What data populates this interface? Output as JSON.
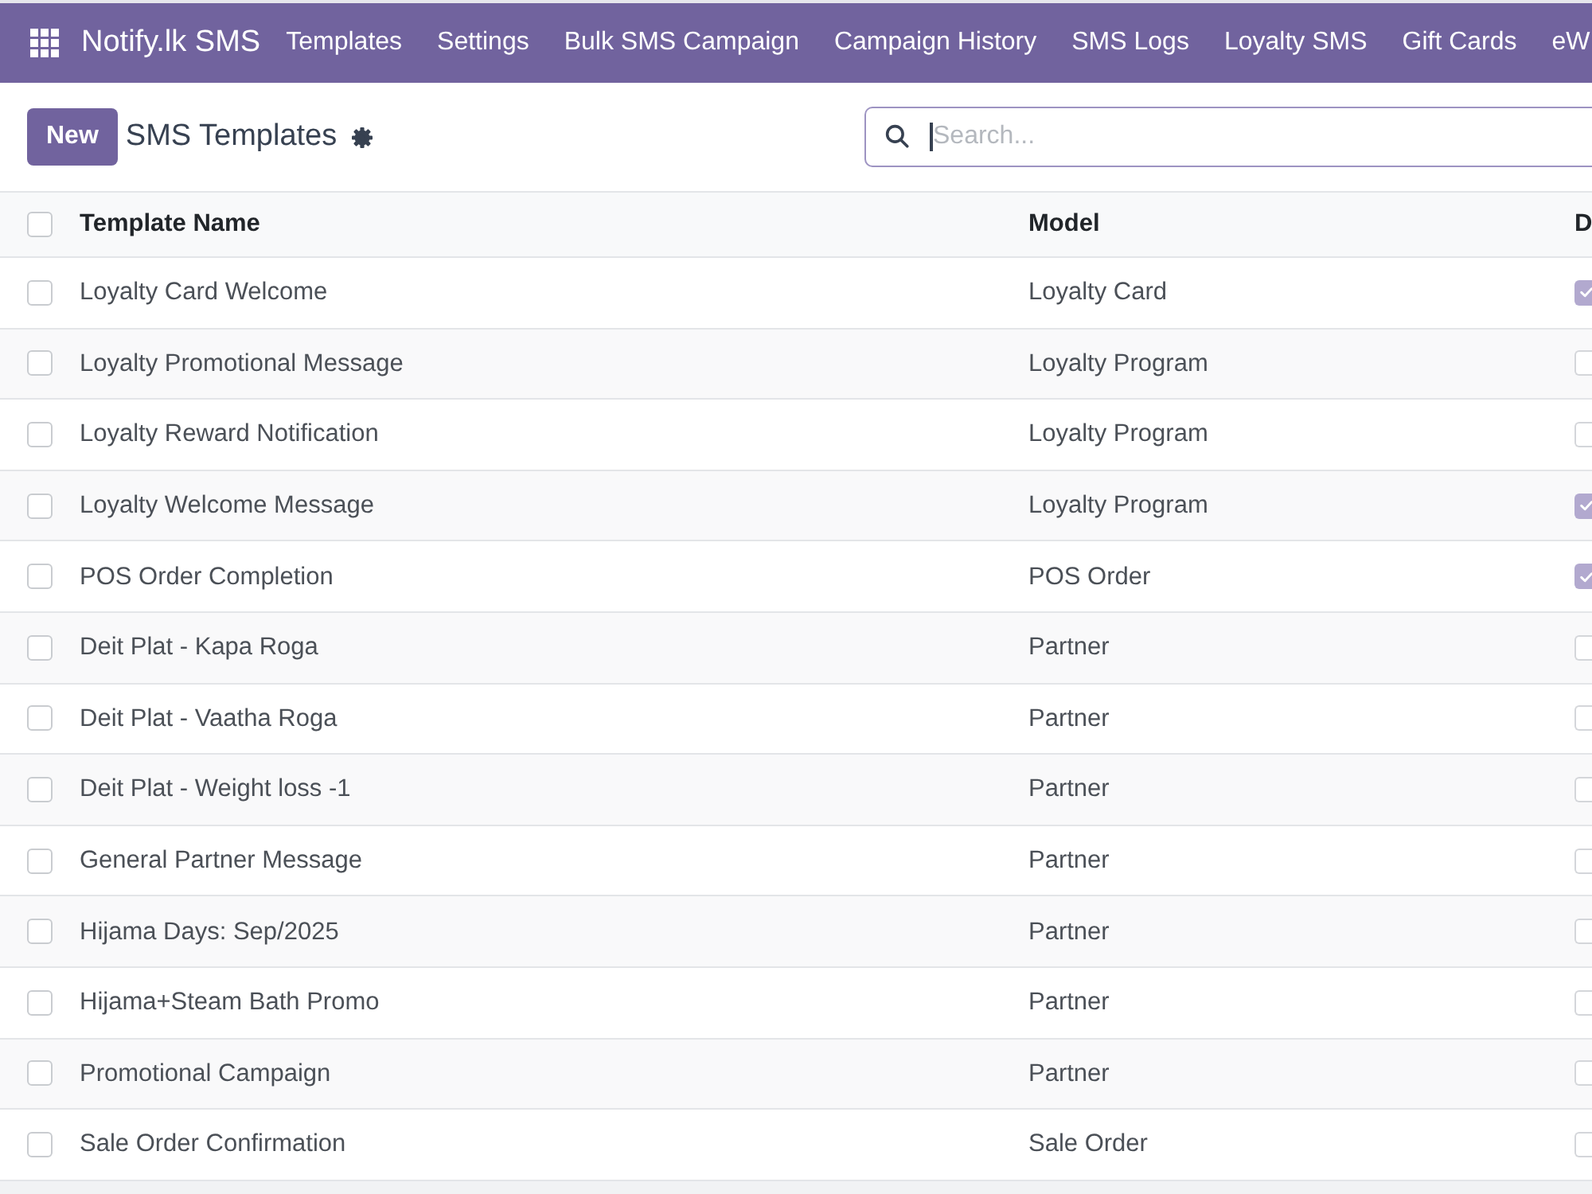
{
  "navbar": {
    "brand": "Notify.lk SMS",
    "menu": [
      "Templates",
      "Settings",
      "Bulk SMS Campaign",
      "Campaign History",
      "SMS Logs",
      "Loyalty SMS",
      "Gift Cards",
      "eW"
    ]
  },
  "control_panel": {
    "new_button": "New",
    "title": "SMS Templates",
    "search": {
      "placeholder": "Search..."
    }
  },
  "table": {
    "select_all": {
      "checked": false
    },
    "columns": [
      "Template Name",
      "Model",
      "D"
    ],
    "rows": [
      {
        "selected": false,
        "name": "Loyalty Card Welcome",
        "model": "Loyalty Card",
        "column_3_checked": true
      },
      {
        "selected": false,
        "name": "Loyalty Promotional Message",
        "model": "Loyalty Program",
        "column_3_checked": false
      },
      {
        "selected": false,
        "name": "Loyalty Reward Notification",
        "model": "Loyalty Program",
        "column_3_checked": false
      },
      {
        "selected": false,
        "name": "Loyalty Welcome Message",
        "model": "Loyalty Program",
        "column_3_checked": true
      },
      {
        "selected": false,
        "name": "POS Order Completion",
        "model": "POS Order",
        "column_3_checked": true
      },
      {
        "selected": false,
        "name": "Deit Plat - Kapa Roga",
        "model": "Partner",
        "column_3_checked": false
      },
      {
        "selected": false,
        "name": "Deit Plat - Vaatha Roga",
        "model": "Partner",
        "column_3_checked": false
      },
      {
        "selected": false,
        "name": "Deit Plat - Weight loss -1",
        "model": "Partner",
        "column_3_checked": false
      },
      {
        "selected": false,
        "name": "General Partner Message",
        "model": "Partner",
        "column_3_checked": false
      },
      {
        "selected": false,
        "name": "Hijama Days: Sep/2025",
        "model": "Partner",
        "column_3_checked": false
      },
      {
        "selected": false,
        "name": "Hijama+Steam Bath Promo",
        "model": "Partner",
        "column_3_checked": false
      },
      {
        "selected": false,
        "name": "Promotional Campaign",
        "model": "Partner",
        "column_3_checked": false
      },
      {
        "selected": false,
        "name": "Sale Order Confirmation",
        "model": "Sale Order",
        "column_3_checked": false
      }
    ]
  }
}
